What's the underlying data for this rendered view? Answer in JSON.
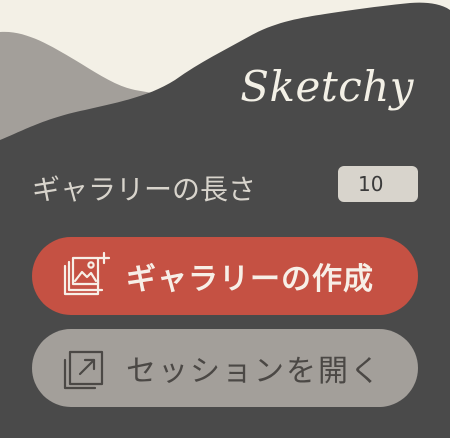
{
  "app": {
    "logo": "Sketchy"
  },
  "gallery_length": {
    "label": "ギャラリーの長さ",
    "value": "10"
  },
  "buttons": {
    "create_gallery": "ギャラリーの作成",
    "open_session": "セッションを開く"
  },
  "icons": {
    "create_gallery": "add-image-icon",
    "open_session": "open-external-icon"
  },
  "colors": {
    "background": "#4a4a4a",
    "sky": "#f3f0e6",
    "hill": "#a39f9a",
    "primary": "#c55143",
    "secondary": "#a39f9a",
    "input": "#d8d4cc"
  }
}
